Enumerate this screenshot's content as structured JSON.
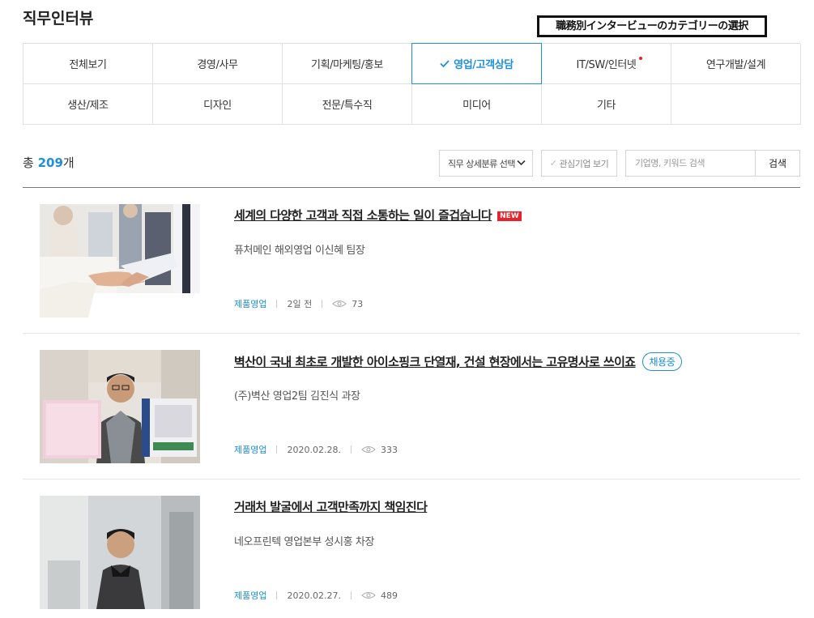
{
  "page": {
    "title": "직무인터뷰"
  },
  "annotation": {
    "text": "職務別インタービューのカテゴリーの選択"
  },
  "categories": [
    {
      "label": "전체보기"
    },
    {
      "label": "경영/사무"
    },
    {
      "label": "기획/마케팅/홍보"
    },
    {
      "label": "영업/고객상담",
      "active": true
    },
    {
      "label": "IT/SW/인터넷",
      "dot": true
    },
    {
      "label": "연구개발/설계"
    },
    {
      "label": "생산/제조"
    },
    {
      "label": "디자인"
    },
    {
      "label": "전문/특수직"
    },
    {
      "label": "미디어"
    },
    {
      "label": "기타"
    },
    {
      "label": ""
    }
  ],
  "summary": {
    "prefix": "총 ",
    "count": "209",
    "suffix": "개"
  },
  "filters": {
    "select_label": "직무 상세분류 선택",
    "fav_label": "관심기업 보기",
    "search_placeholder": "기업명, 키워드 검색",
    "search_button": "검색"
  },
  "colors": {
    "accent": "#1e8fd8",
    "new_badge": "#e8212a",
    "border": "#e0e0e0"
  },
  "interviews": [
    {
      "title": "세계의 다양한 고객과 직접 소통하는 일이 즐겁습니다",
      "badge_new": "NEW",
      "subtitle": "퓨처메인 해외영업 이신혜 팀장",
      "category": "제품영업",
      "date": "2일 전",
      "views": "73"
    },
    {
      "title": "벽산이 국내 최초로 개발한 아이소핑크 단열재, 건설 현장에서는 고유명사로 쓰이죠",
      "badge_hiring": "채용중",
      "subtitle": "(주)벽산 영업2팀 김진식 과장",
      "category": "제품영업",
      "date": "2020.02.28.",
      "views": "333"
    },
    {
      "title": "거래처 발굴에서 고객만족까지 책임진다",
      "subtitle": "네오프린텍 영업본부 성시홍 차장",
      "category": "제품영업",
      "date": "2020.02.27.",
      "views": "489"
    }
  ]
}
